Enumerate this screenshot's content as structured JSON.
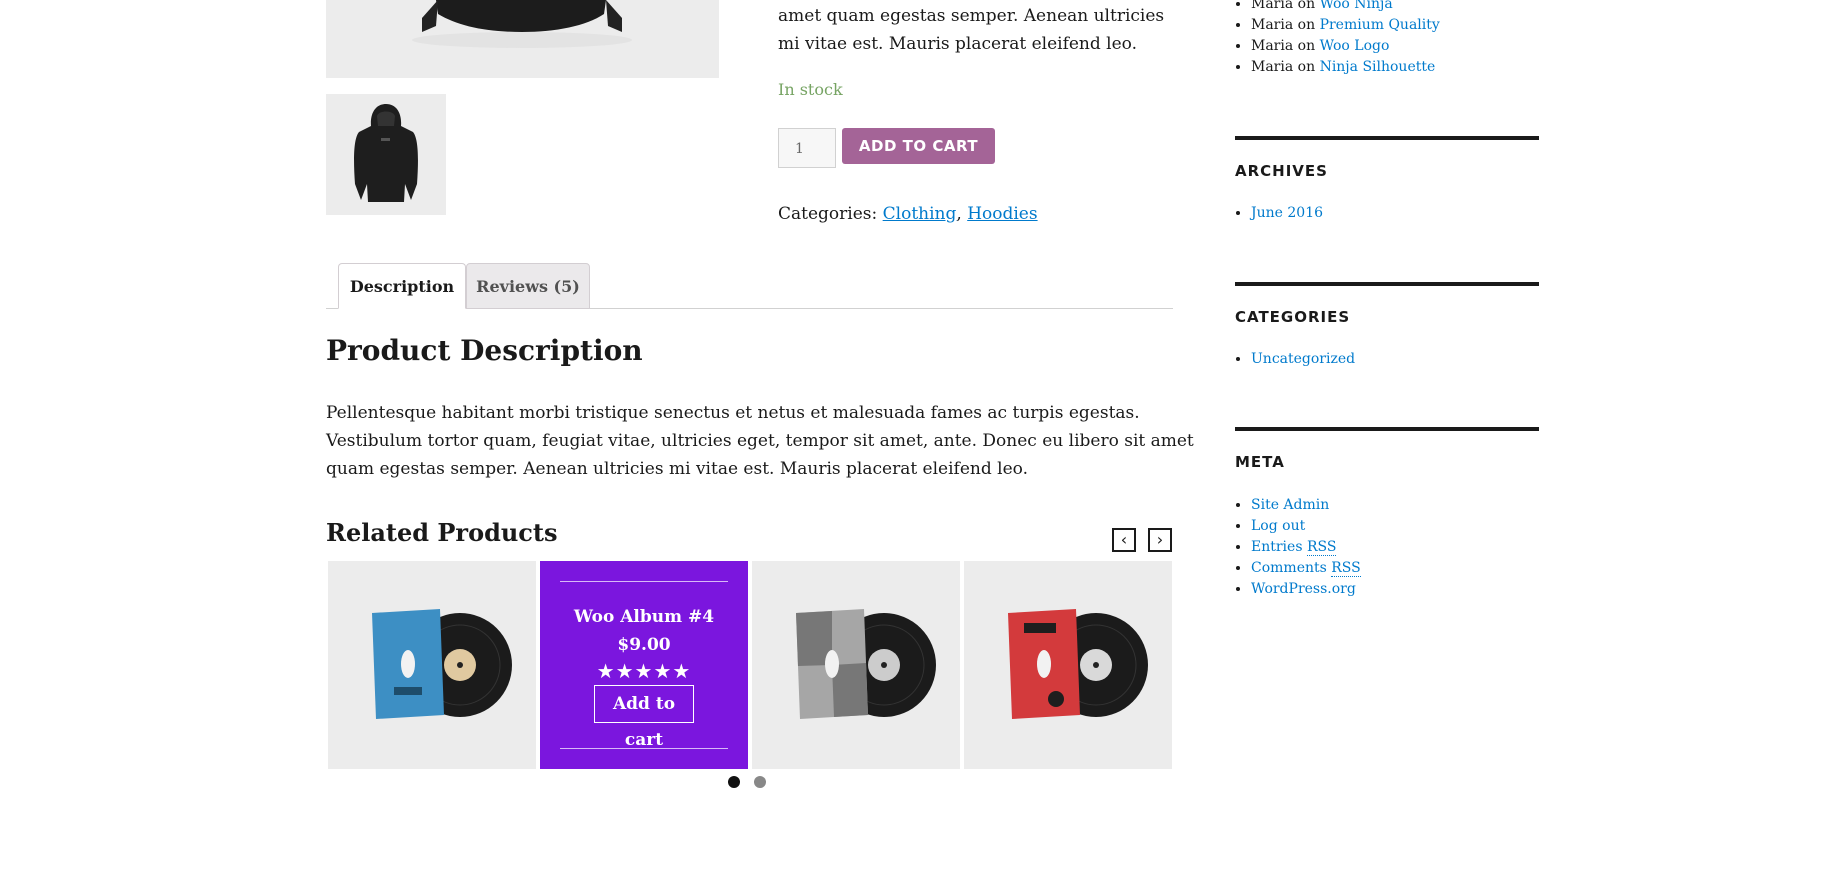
{
  "summary": {
    "description_tail": "amet quam egestas semper. Aenean ultricies mi vitae est. Mauris placerat eleifend leo.",
    "stock": "In stock",
    "quantity": "1",
    "add_to_cart": "ADD TO CART",
    "categories_label": "Categories:",
    "categories": [
      "Clothing",
      "Hoodies"
    ],
    "categories_sep": ","
  },
  "tabs": [
    {
      "label": "Description",
      "active": true
    },
    {
      "label": "Reviews (5)",
      "active": false
    }
  ],
  "description": {
    "title": "Product Description",
    "body": "Pellentesque habitant morbi tristique senectus et netus et malesuada fames ac turpis egestas. Vestibulum tortor quam, feugiat vitae, ultricies eget, tempor sit amet, ante. Donec eu libero sit amet quam egestas semper. Aenean ultricies mi vitae est. Mauris placerat eleifend leo."
  },
  "related": {
    "title": "Related Products",
    "prev_icon": "chevron-left-icon",
    "next_icon": "chevron-right-icon",
    "hover_card": {
      "name": "Woo Album #4",
      "price": "$9.00",
      "rating": 5,
      "stars": "★★★★★",
      "cta": "Add to cart"
    },
    "covers": [
      {
        "color": "#3d8fc4",
        "art": "WOOTHEMES"
      },
      {
        "color": "#7b16de",
        "art": ""
      },
      {
        "color": "#9a9a9a",
        "art": "ninjas"
      },
      {
        "color": "#d33a3c",
        "art": "WOOTHEMES"
      }
    ],
    "pages": 2,
    "active_page": 1
  },
  "sidebar": {
    "recent_comments": [
      {
        "author": "Maria",
        "on": "on",
        "post": "Woo Ninja"
      },
      {
        "author": "Maria",
        "on": "on",
        "post": "Premium Quality"
      },
      {
        "author": "Maria",
        "on": "on",
        "post": "Woo Logo"
      },
      {
        "author": "Maria",
        "on": "on",
        "post": "Ninja Silhouette"
      }
    ],
    "archives": {
      "title": "ARCHIVES",
      "items": [
        "June 2016"
      ]
    },
    "categories": {
      "title": "CATEGORIES",
      "items": [
        "Uncategorized"
      ]
    },
    "meta": {
      "title": "META",
      "site_admin": "Site Admin",
      "log_out": "Log out",
      "entries": "Entries",
      "comments": "Comments",
      "rss": "RSS",
      "wordpress": "WordPress.org"
    }
  },
  "colors": {
    "accent": "#a46497",
    "link": "#007acc",
    "in_stock": "#77a464",
    "hover_overlay": "#7b16de"
  }
}
